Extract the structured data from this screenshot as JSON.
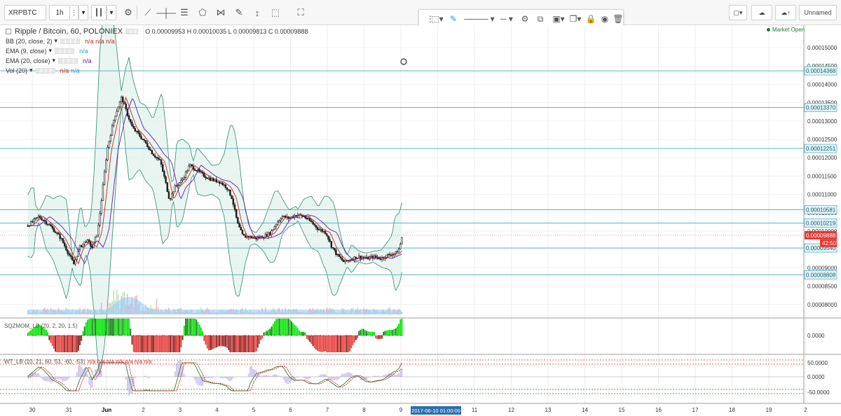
{
  "toolbar": {
    "symbol": "XRPBTC",
    "interval": "1h",
    "layout_name": "Unnamed"
  },
  "legend": {
    "title": "Ripple / Bitcoin, 60, POLONIEX",
    "ohlc": "O 0.00009953 H 0.00010035 L 0.00009813 C 0.00009888",
    "bb": "BB (20, close, 2)",
    "ema9": "EMA (9, close)",
    "ema20": "EMA (20, close)",
    "vol": "Vol (20)",
    "na": "n/a",
    "bb_na": "n/a n/a n/a",
    "market_status": "Market Open"
  },
  "indicators": {
    "sqz": "SQZMOM_LB (20, 2, 20, 1.5)",
    "wt": "WT_LB (10, 21, 60, 53, -60, -53)",
    "wt_na": "n/a n/a n/a n/a n/a n/a n/a"
  },
  "crosshair_date": "2017-06-10 01:00:00",
  "price_badges": {
    "current": "0.00009888",
    "countdown": "42:50"
  },
  "chart_data": {
    "type": "candlestick",
    "title": "Ripple / Bitcoin, 60, POLONIEX",
    "x_ticks": [
      "30",
      "31",
      "Jun",
      "2",
      "3",
      "4",
      "5",
      "6",
      "7",
      "8",
      "9",
      "10",
      "11",
      "12",
      "13",
      "14",
      "15",
      "16",
      "17",
      "18",
      "19",
      "2"
    ],
    "y_ticks": [
      "0.00015000",
      "0.00014500",
      "0.00014000",
      "0.00013500",
      "0.00013000",
      "0.00012500",
      "0.00012000",
      "0.00011500",
      "0.00011000",
      "0.00010500",
      "0.00010000",
      "0.00009500",
      "0.00009000",
      "0.00008500",
      "0.00008000"
    ],
    "ylim": [
      7.9e-05,
      0.0001523
    ],
    "horizontal_levels": [
      "0.00014368",
      "0.00013370",
      "0.00012251",
      "0.00010581",
      "0.00010219",
      "0.00009540",
      "0.00008808"
    ],
    "current_price": 9.888e-05,
    "price_path": [
      [
        0,
        0.0001015
      ],
      [
        0.3,
        0.000104
      ],
      [
        0.6,
        0.0001015
      ],
      [
        0.9,
        9.8e-05
      ],
      [
        1.1,
        9.4e-05
      ],
      [
        1.25,
        9.1e-05
      ],
      [
        1.4,
        9.55e-05
      ],
      [
        1.6,
        9.75e-05
      ],
      [
        1.75,
        9.55e-05
      ],
      [
        1.9,
        0.0001
      ],
      [
        2.0,
        0.0001085
      ],
      [
        2.15,
        0.000122
      ],
      [
        2.35,
        0.000131
      ],
      [
        2.55,
        0.0001365
      ],
      [
        2.7,
        0.000132
      ],
      [
        2.85,
        0.000128
      ],
      [
        3.0,
        0.0001265
      ],
      [
        3.2,
        0.000124
      ],
      [
        3.4,
        0.000121
      ],
      [
        3.6,
        0.000119
      ],
      [
        3.75,
        0.000113
      ],
      [
        3.85,
        0.0001085
      ],
      [
        4.0,
        0.000112
      ],
      [
        4.2,
        0.000114
      ],
      [
        4.4,
        0.000118
      ],
      [
        4.6,
        0.0001165
      ],
      [
        4.8,
        0.000115
      ],
      [
        5.0,
        0.000114
      ],
      [
        5.2,
        0.0001135
      ],
      [
        5.4,
        0.000112
      ],
      [
        5.55,
        0.000109
      ],
      [
        5.7,
        0.000102
      ],
      [
        5.85,
        9.85e-05
      ],
      [
        6.0,
        9.85e-05
      ],
      [
        6.2,
        9.8e-05
      ],
      [
        6.4,
        9.85e-05
      ],
      [
        6.6,
        9.95e-05
      ],
      [
        6.75,
        0.000102
      ],
      [
        6.9,
        0.000104
      ],
      [
        7.1,
        0.0001035
      ],
      [
        7.3,
        0.0001045
      ],
      [
        7.5,
        0.000104
      ],
      [
        7.7,
        0.0001025
      ],
      [
        7.9,
        0.0001005
      ],
      [
        8.1,
        9.96e-05
      ],
      [
        8.25,
        9.6e-05
      ],
      [
        8.4,
        9.35e-05
      ],
      [
        8.6,
        9.15e-05
      ],
      [
        8.8,
        9.25e-05
      ],
      [
        9.0,
        9.3e-05
      ],
      [
        9.2,
        9.25e-05
      ],
      [
        9.4,
        9.3e-05
      ],
      [
        9.6,
        9.25e-05
      ],
      [
        9.8,
        9.35e-05
      ],
      [
        10.0,
        9.4e-05
      ],
      [
        10.1,
        9.53e-05
      ],
      [
        10.18,
        9.89e-05
      ]
    ]
  }
}
